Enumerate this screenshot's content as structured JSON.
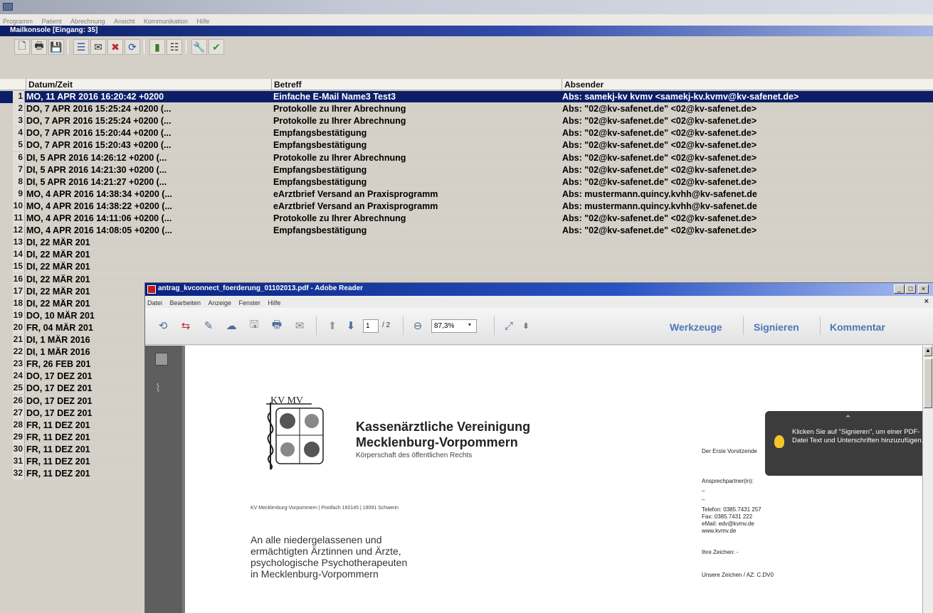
{
  "app": {
    "title": "",
    "menu": [
      "Programm",
      "Patient",
      "Abrechnung",
      "Ansicht",
      "Kommunikation",
      "Hilfe"
    ]
  },
  "mailconsole": {
    "title": "Mailkonsole [Eingang: 35]",
    "columns": {
      "date": "Datum/Zeit",
      "subject": "Betreff",
      "sender": "Absender"
    },
    "rows": [
      {
        "num": "1",
        "date": "MO, 11 APR 2016 16:20:42 +0200",
        "subject": "Einfache E-Mail Name3 Test3",
        "sender": "Abs: samekj-kv kvmv <samekj-kv.kvmv@kv-safenet.de>"
      },
      {
        "num": "2",
        "date": "DO, 7 APR 2016 15:25:24 +0200 (...",
        "subject": "Protokolle zu Ihrer Abrechnung",
        "sender": "Abs: \"02@kv-safenet.de\" <02@kv-safenet.de>"
      },
      {
        "num": "3",
        "date": "DO, 7 APR 2016 15:25:24 +0200 (...",
        "subject": "Protokolle zu Ihrer Abrechnung",
        "sender": "Abs: \"02@kv-safenet.de\" <02@kv-safenet.de>"
      },
      {
        "num": "4",
        "date": "DO, 7 APR 2016 15:20:44 +0200 (...",
        "subject": "Empfangsbestätigung",
        "sender": "Abs: \"02@kv-safenet.de\" <02@kv-safenet.de>"
      },
      {
        "num": "5",
        "date": "DO, 7 APR 2016 15:20:43 +0200 (...",
        "subject": "Empfangsbestätigung",
        "sender": "Abs: \"02@kv-safenet.de\" <02@kv-safenet.de>"
      },
      {
        "num": "6",
        "date": "DI, 5 APR 2016 14:26:12 +0200 (...",
        "subject": "Protokolle zu Ihrer Abrechnung",
        "sender": "Abs: \"02@kv-safenet.de\" <02@kv-safenet.de>"
      },
      {
        "num": "7",
        "date": "DI, 5 APR 2016 14:21:30 +0200 (...",
        "subject": "Empfangsbestätigung",
        "sender": "Abs: \"02@kv-safenet.de\" <02@kv-safenet.de>"
      },
      {
        "num": "8",
        "date": "DI, 5 APR 2016 14:21:27 +0200 (...",
        "subject": "Empfangsbestätigung",
        "sender": "Abs: \"02@kv-safenet.de\" <02@kv-safenet.de>"
      },
      {
        "num": "9",
        "date": "MO, 4 APR 2016 14:38:34 +0200 (...",
        "subject": "eArztbrief Versand an Praxisprogramm",
        "sender": "Abs: mustermann.quincy.kvhh@kv-safenet.de"
      },
      {
        "num": "10",
        "date": "MO, 4 APR 2016 14:38:22 +0200 (...",
        "subject": "eArztbrief Versand an Praxisprogramm",
        "sender": "Abs: mustermann.quincy.kvhh@kv-safenet.de"
      },
      {
        "num": "11",
        "date": "MO, 4 APR 2016 14:11:06 +0200 (...",
        "subject": "Protokolle zu Ihrer Abrechnung",
        "sender": "Abs: \"02@kv-safenet.de\" <02@kv-safenet.de>"
      },
      {
        "num": "12",
        "date": "MO, 4 APR 2016 14:08:05 +0200 (...",
        "subject": "Empfangsbestätigung",
        "sender": "Abs: \"02@kv-safenet.de\" <02@kv-safenet.de>"
      },
      {
        "num": "13",
        "date": "DI, 22 MÄR 201",
        "subject": "",
        "sender": ""
      },
      {
        "num": "14",
        "date": "DI, 22 MÄR 201",
        "subject": "",
        "sender": ""
      },
      {
        "num": "15",
        "date": "DI, 22 MÄR 201",
        "subject": "",
        "sender": ""
      },
      {
        "num": "16",
        "date": "DI, 22 MÄR 201",
        "subject": "",
        "sender": ""
      },
      {
        "num": "17",
        "date": "DI, 22 MÄR 201",
        "subject": "",
        "sender": ""
      },
      {
        "num": "18",
        "date": "DI, 22 MÄR 201",
        "subject": "",
        "sender": ""
      },
      {
        "num": "19",
        "date": "DO, 10 MÄR 201",
        "subject": "",
        "sender": ""
      },
      {
        "num": "20",
        "date": "FR, 04 MÄR 201",
        "subject": "",
        "sender": ""
      },
      {
        "num": "21",
        "date": "DI, 1 MÄR 2016",
        "subject": "",
        "sender": ""
      },
      {
        "num": "22",
        "date": "DI, 1 MÄR 2016",
        "subject": "",
        "sender": ""
      },
      {
        "num": "23",
        "date": "FR, 26 FEB 201",
        "subject": "",
        "sender": ""
      },
      {
        "num": "24",
        "date": "DO, 17 DEZ 201",
        "subject": "",
        "sender": ""
      },
      {
        "num": "25",
        "date": "DO, 17 DEZ 201",
        "subject": "",
        "sender": ""
      },
      {
        "num": "26",
        "date": "DO, 17 DEZ 201",
        "subject": "",
        "sender": ""
      },
      {
        "num": "27",
        "date": "DO, 17 DEZ 201",
        "subject": "",
        "sender": ""
      },
      {
        "num": "28",
        "date": "FR, 11 DEZ 201",
        "subject": "",
        "sender": ""
      },
      {
        "num": "29",
        "date": "FR, 11 DEZ 201",
        "subject": "",
        "sender": ""
      },
      {
        "num": "30",
        "date": "FR, 11 DEZ 201",
        "subject": "",
        "sender": ""
      },
      {
        "num": "31",
        "date": "FR, 11 DEZ 201",
        "subject": "",
        "sender": ""
      },
      {
        "num": "32",
        "date": "FR, 11 DEZ 201",
        "subject": "",
        "sender": ""
      }
    ]
  },
  "reader": {
    "title": "antrag_kvconnect_foerderung_01102013.pdf - Adobe Reader",
    "menu": [
      "Datei",
      "Bearbeiten",
      "Anzeige",
      "Fenster",
      "Hilfe"
    ],
    "page_current": "1",
    "page_total": "/ 2",
    "zoom": "87,3%",
    "links": {
      "tools": "Werkzeuge",
      "sign": "Signieren",
      "comment": "Kommentar"
    },
    "tooltip": "Klicken Sie auf \"Signieren\", um einer PDF-Datei Text und Unterschriften hinzuzufügen.",
    "pdf": {
      "logo_text": "KV MV",
      "org_name_1": "Kassenärztliche Vereinigung",
      "org_name_2": "Mecklenburg-Vorpommern",
      "org_sub": "Körperschaft des öffentlichen Rechts",
      "address_line": "KV Mecklenburg-Vorpommern | Postfach 160145 | 19091 Schwerin",
      "recipient_1": "An alle niedergelassenen und",
      "recipient_2": "ermächtigten Ärztinnen und Ärzte,",
      "recipient_3": "psychologische Psychotherapeuten",
      "recipient_4": "in Mecklenburg-Vorpommern",
      "right_1": "Der Erste Vorsitzende",
      "right_2": "Ansprechpartner(in):",
      "right_3": "–",
      "right_4": "–",
      "right_5": "Telefon: 0385.7431 257",
      "right_6": "Fax:     0385.7431 222",
      "right_7": "eMail:   edv@kvmv.de",
      "right_8": "www.kvmv.de",
      "right_9": "Ihre Zeichen: -",
      "right_10": "Unsere Zeichen / AZ: C.DV0"
    }
  }
}
